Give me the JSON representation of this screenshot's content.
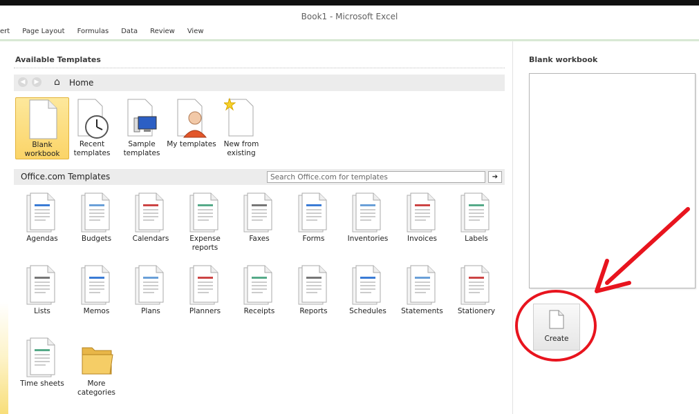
{
  "window": {
    "title": "Book1  -  Microsoft Excel"
  },
  "ribbon": {
    "tabs": [
      "ert",
      "Page Layout",
      "Formulas",
      "Data",
      "Review",
      "View"
    ]
  },
  "available_templates": {
    "title": "Available Templates",
    "nav": {
      "back_icon": "back-arrow-icon",
      "forward_icon": "forward-arrow-icon",
      "home_icon": "home-icon",
      "home_label": "Home"
    },
    "items": [
      {
        "label1": "Blank",
        "label2": "workbook",
        "icon": "blank-workbook-icon",
        "selected": true
      },
      {
        "label1": "Recent",
        "label2": "templates",
        "icon": "recent-templates-icon"
      },
      {
        "label1": "Sample",
        "label2": "templates",
        "icon": "sample-templates-icon"
      },
      {
        "label1": "My templates",
        "label2": "",
        "icon": "my-templates-icon"
      },
      {
        "label1": "New from",
        "label2": "existing",
        "icon": "new-from-existing-icon"
      }
    ]
  },
  "office_templates": {
    "title": "Office.com Templates",
    "search_placeholder": "Search Office.com for templates",
    "search_go_icon": "arrow-right-icon",
    "items": [
      {
        "label1": "Agendas",
        "label2": "",
        "icon": "agendas-icon"
      },
      {
        "label1": "Budgets",
        "label2": "",
        "icon": "budgets-icon"
      },
      {
        "label1": "Calendars",
        "label2": "",
        "icon": "calendars-icon"
      },
      {
        "label1": "Expense",
        "label2": "reports",
        "icon": "expense-reports-icon"
      },
      {
        "label1": "Faxes",
        "label2": "",
        "icon": "faxes-icon"
      },
      {
        "label1": "Forms",
        "label2": "",
        "icon": "forms-icon"
      },
      {
        "label1": "Inventories",
        "label2": "",
        "icon": "inventories-icon"
      },
      {
        "label1": "Invoices",
        "label2": "",
        "icon": "invoices-icon"
      },
      {
        "label1": "Labels",
        "label2": "",
        "icon": "labels-icon"
      },
      {
        "label1": "Lists",
        "label2": "",
        "icon": "lists-icon"
      },
      {
        "label1": "Memos",
        "label2": "",
        "icon": "memos-icon"
      },
      {
        "label1": "Plans",
        "label2": "",
        "icon": "plans-icon"
      },
      {
        "label1": "Planners",
        "label2": "",
        "icon": "planners-icon"
      },
      {
        "label1": "Receipts",
        "label2": "",
        "icon": "receipts-icon"
      },
      {
        "label1": "Reports",
        "label2": "",
        "icon": "reports-icon"
      },
      {
        "label1": "Schedules",
        "label2": "",
        "icon": "schedules-icon"
      },
      {
        "label1": "Statements",
        "label2": "",
        "icon": "statements-icon"
      },
      {
        "label1": "Stationery",
        "label2": "",
        "icon": "stationery-icon"
      },
      {
        "label1": "Time sheets",
        "label2": "",
        "icon": "time-sheets-icon"
      },
      {
        "label1": "More",
        "label2": "categories",
        "icon": "folder-icon"
      }
    ]
  },
  "preview": {
    "title": "Blank workbook",
    "create_label": "Create",
    "create_icon": "blank-page-icon"
  },
  "colors": {
    "selected_fill": "#fbd467",
    "selected_border": "#e2b33c",
    "annotation": "#e8141e",
    "ribbon_accent": "#c9e0c4"
  }
}
